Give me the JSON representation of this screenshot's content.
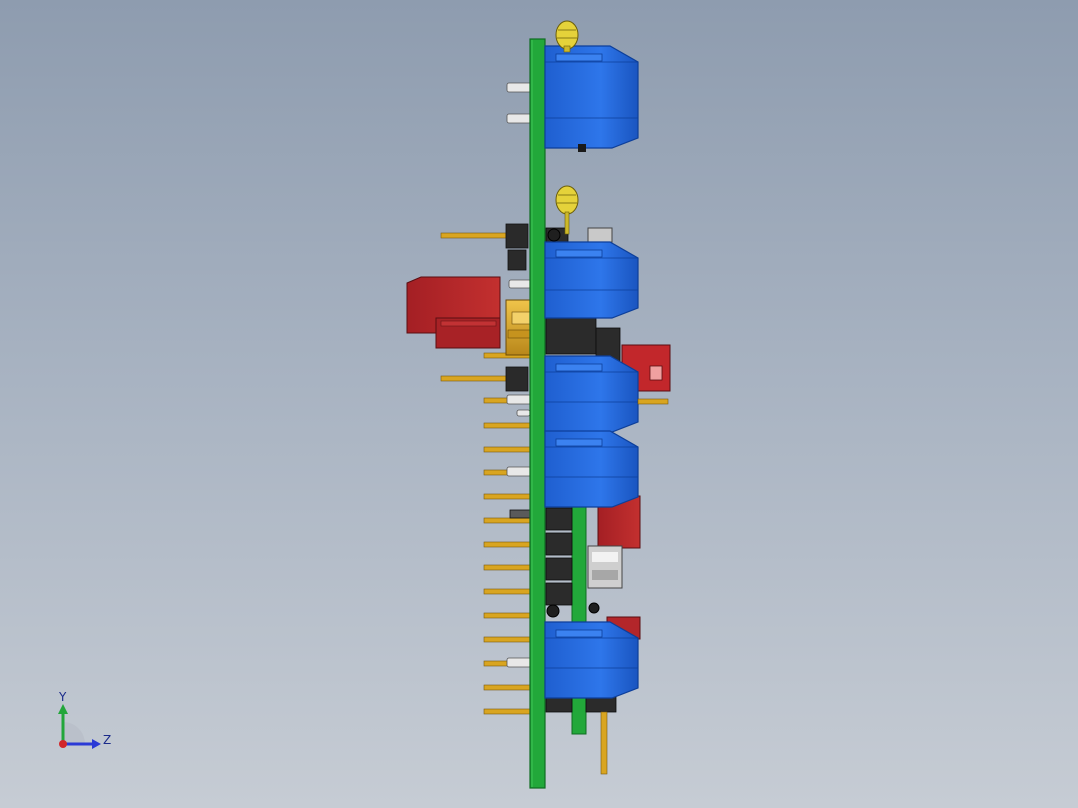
{
  "triad": {
    "y_label": "Y",
    "z_label": "Z"
  },
  "colors": {
    "pcb": "#22a83a",
    "pcb_dark": "#0f6d22",
    "terminal_blue": "#2a6fe0",
    "terminal_blue_dark": "#0d3f9a",
    "connector_red": "#b3262a",
    "pin_gold": "#d9a520",
    "header_black": "#2a2a2a",
    "led_yellow": "#e5d23a",
    "axis_green": "#22a63a",
    "axis_blue": "#2b3ad6",
    "origin_red": "#d2252a"
  },
  "icons": {
    "axis": "coordinate-triad-icon"
  }
}
